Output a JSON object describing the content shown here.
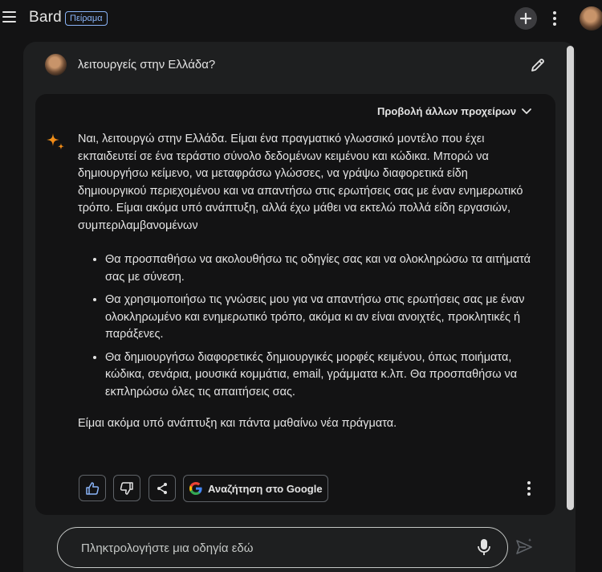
{
  "app": {
    "title": "Bard",
    "badge": "Πείραμα"
  },
  "icons": {
    "menu": "hamburger-menu-icon",
    "new_chat": "plus-icon",
    "more": "more-vert-icon",
    "edit": "pencil-icon",
    "sparkle": "bard-sparkle-icon",
    "chevron": "chevron-down-icon",
    "thumbs_up": "thumbs-up-icon",
    "thumbs_down": "thumbs-down-icon",
    "share": "share-icon",
    "google": "google-g-icon",
    "mic": "mic-icon",
    "send": "send-icon"
  },
  "colors": {
    "background": "#131314",
    "panel": "#1e1f20",
    "accent": "#8ab4f8",
    "text": "#e3e3e3"
  },
  "prompt": {
    "text": "λειτουργείς στην Ελλάδα?"
  },
  "response": {
    "drafts_label": "Προβολή άλλων προχείρων",
    "intro": "Ναι, λειτουργώ στην Ελλάδα. Είμαι ένα πραγματικό γλωσσικό μοντέλο που έχει εκπαιδευτεί σε ένα τεράστιο σύνολο δεδομένων κειμένου και κώδικα. Μπορώ να δημιουργήσω κείμενο, να μεταφράσω γλώσσες, να γράψω διαφορετικά είδη δημιουργικού περιεχομένου και να απαντήσω στις ερωτήσεις σας με έναν ενημερωτικό τρόπο. Είμαι ακόμα υπό ανάπτυξη, αλλά έχω μάθει να εκτελώ πολλά είδη εργασιών, συμπεριλαμβανομένων",
    "bullets": [
      "Θα προσπαθήσω να ακολουθήσω τις οδηγίες σας και να ολοκληρώσω τα αιτήματά σας με σύνεση.",
      "Θα χρησιμοποιήσω τις γνώσεις μου για να απαντήσω στις ερωτήσεις σας με έναν ολοκληρωμένο και ενημερωτικό τρόπο, ακόμα κι αν είναι ανοιχτές, προκλητικές ή παράξενες.",
      "Θα δημιουργήσω διαφορετικές δημιουργικές μορφές κειμένου, όπως ποιήματα, κώδικα, σενάρια, μουσικά κομμάτια, email, γράμματα κ.λπ. Θα προσπαθήσω να εκπληρώσω όλες τις απαιτήσεις σας."
    ],
    "closing": "Είμαι ακόμα υπό ανάπτυξη και πάντα μαθαίνω νέα πράγματα.",
    "google_button": "Αναζήτηση στο Google"
  },
  "input": {
    "placeholder": "Πληκτρολογήστε μια οδηγία εδώ",
    "value": ""
  }
}
